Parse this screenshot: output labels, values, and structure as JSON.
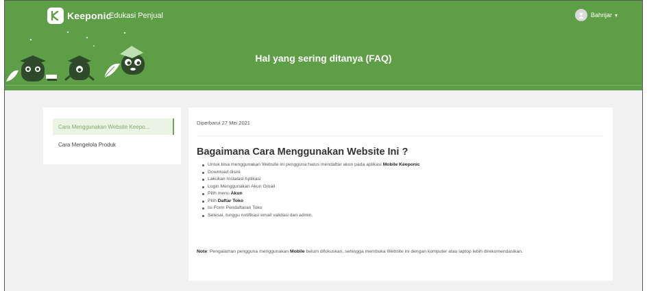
{
  "header": {
    "brand_name": "Keeponic",
    "nav_link": "Edukasi Penjual",
    "user_name": "Bahrijar",
    "user_caret": "▾",
    "page_title": "Hal yang sering ditanya (FAQ)"
  },
  "sidebar": {
    "items": [
      {
        "label": "Cara Menggunakan Website Keepo..."
      },
      {
        "label": "Cara Mengelola Produk"
      }
    ]
  },
  "article": {
    "updated": "Diperbarui 27 Mei 2021",
    "title": "Bagaimana Cara Menggunakan Website Ini ?",
    "steps": [
      {
        "pre": "Untuk bisa menggunakan Website ini pengguna harus mendaftar akun pada aplikasi ",
        "bold": "Mobile Keeponic"
      },
      {
        "pre": "Download disini",
        "bold": ""
      },
      {
        "pre": "Lakukan Instalasi Aplikasi",
        "bold": ""
      },
      {
        "pre": "Login Menggunakan Akun Gmail",
        "bold": ""
      },
      {
        "pre": "Pilih menu ",
        "bold": "Akun"
      },
      {
        "pre": "Pilih ",
        "bold": "Daftar Toko"
      },
      {
        "pre": "Isi Form Pendaftaran Toko",
        "bold": ""
      },
      {
        "pre": "Selesai, tunggu notifikasi email validasi dari admin.",
        "bold": ""
      }
    ],
    "note_label": "Note",
    "note_text_1": ": Pengalaman pengguna menggunakan ",
    "note_bold": "Mobile",
    "note_text_2": " belum difokuskan, sehingga membuka Website ini dengan komputer atau laptop lebih direkomendasikan."
  },
  "colors": {
    "brand_green": "#5e9e46",
    "active_item_bg": "#ebf4e4",
    "page_bg": "#f1f1f1"
  },
  "icons": [
    "keeponic-logo-icon",
    "user-avatar-icon",
    "chevron-down-icon",
    "mascot-illustration"
  ]
}
